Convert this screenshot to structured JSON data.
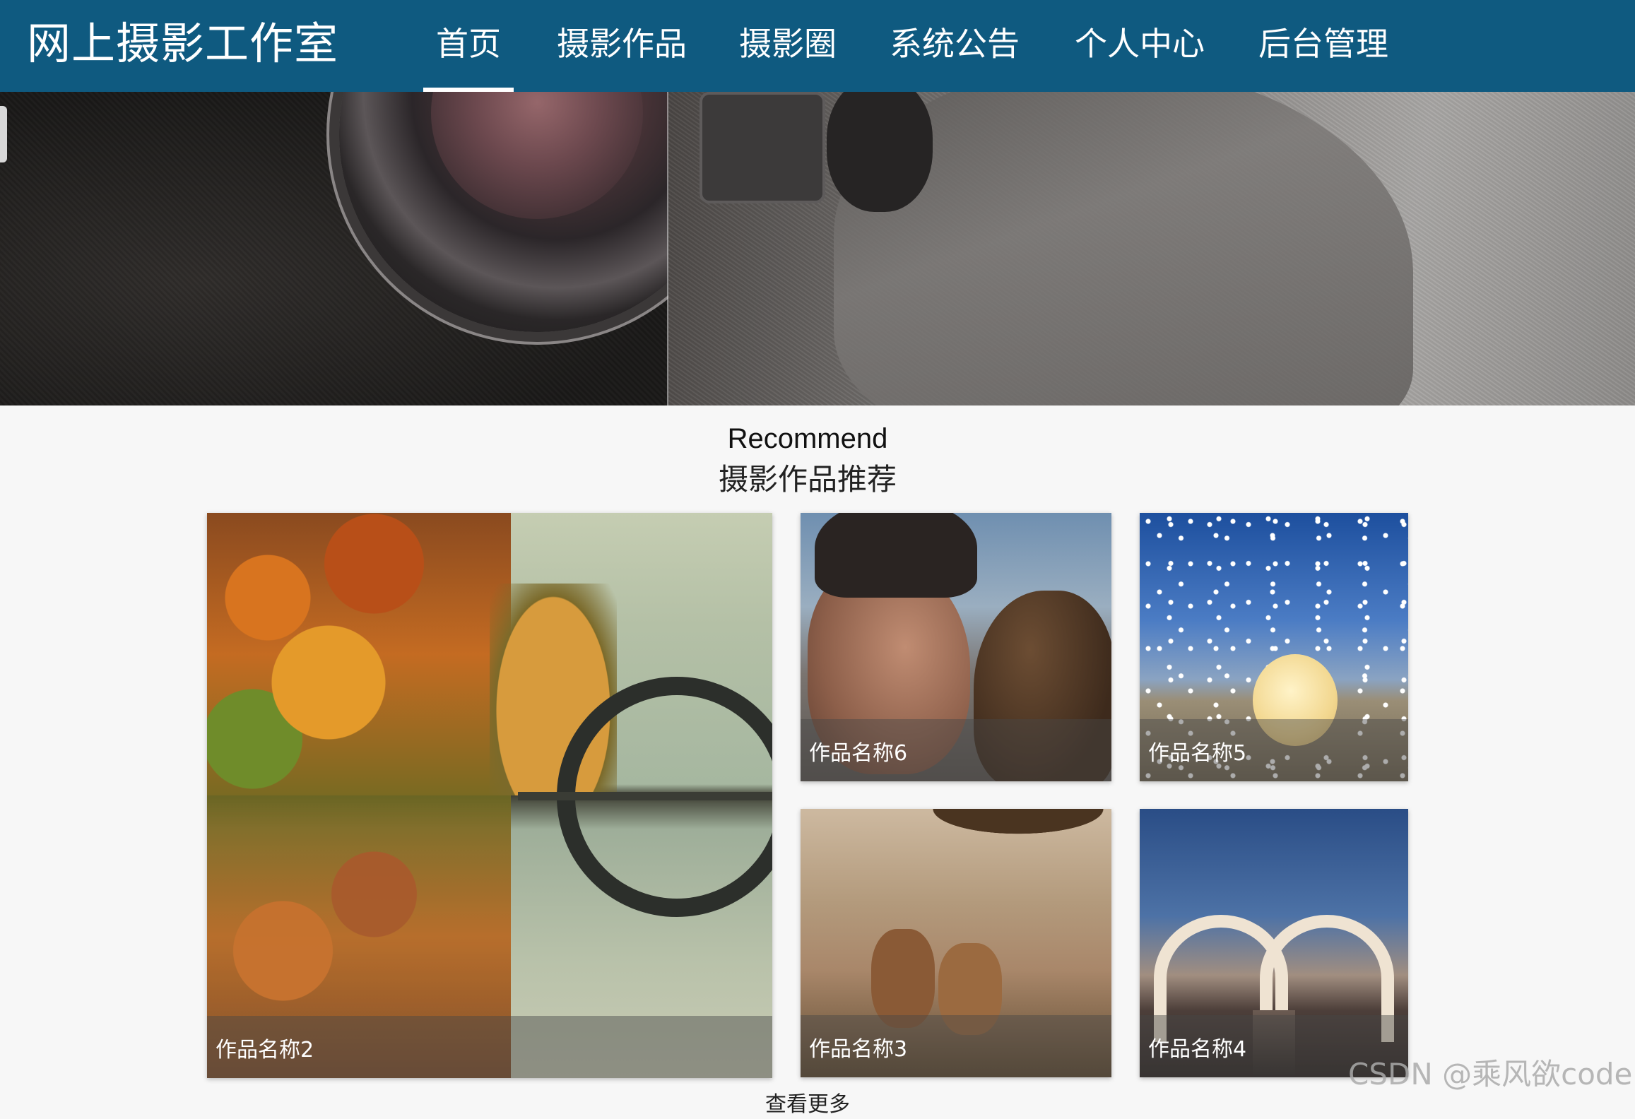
{
  "header": {
    "brand": "网上摄影工作室",
    "nav": [
      {
        "label": "首页",
        "active": true
      },
      {
        "label": "摄影作品",
        "active": false
      },
      {
        "label": "摄影圈",
        "active": false
      },
      {
        "label": "系统公告",
        "active": false
      },
      {
        "label": "个人中心",
        "active": false
      },
      {
        "label": "后台管理",
        "active": false
      }
    ]
  },
  "banner": {
    "slide_count": 3,
    "active_slide": 2
  },
  "section": {
    "title_en": "Recommend",
    "title_zh": "摄影作品推荐"
  },
  "works": [
    {
      "caption": "作品名称2"
    },
    {
      "caption": "作品名称6"
    },
    {
      "caption": "作品名称5"
    },
    {
      "caption": "作品名称3"
    },
    {
      "caption": "作品名称4"
    }
  ],
  "footer": {
    "more_label": "查看更多",
    "watermark": "CSDN @乘风欲code"
  },
  "colors": {
    "navbar": "#0f5a80",
    "nav_text": "#ffffff",
    "active_dot": "#0f5a80",
    "page_bg": "#f7f7f7"
  }
}
